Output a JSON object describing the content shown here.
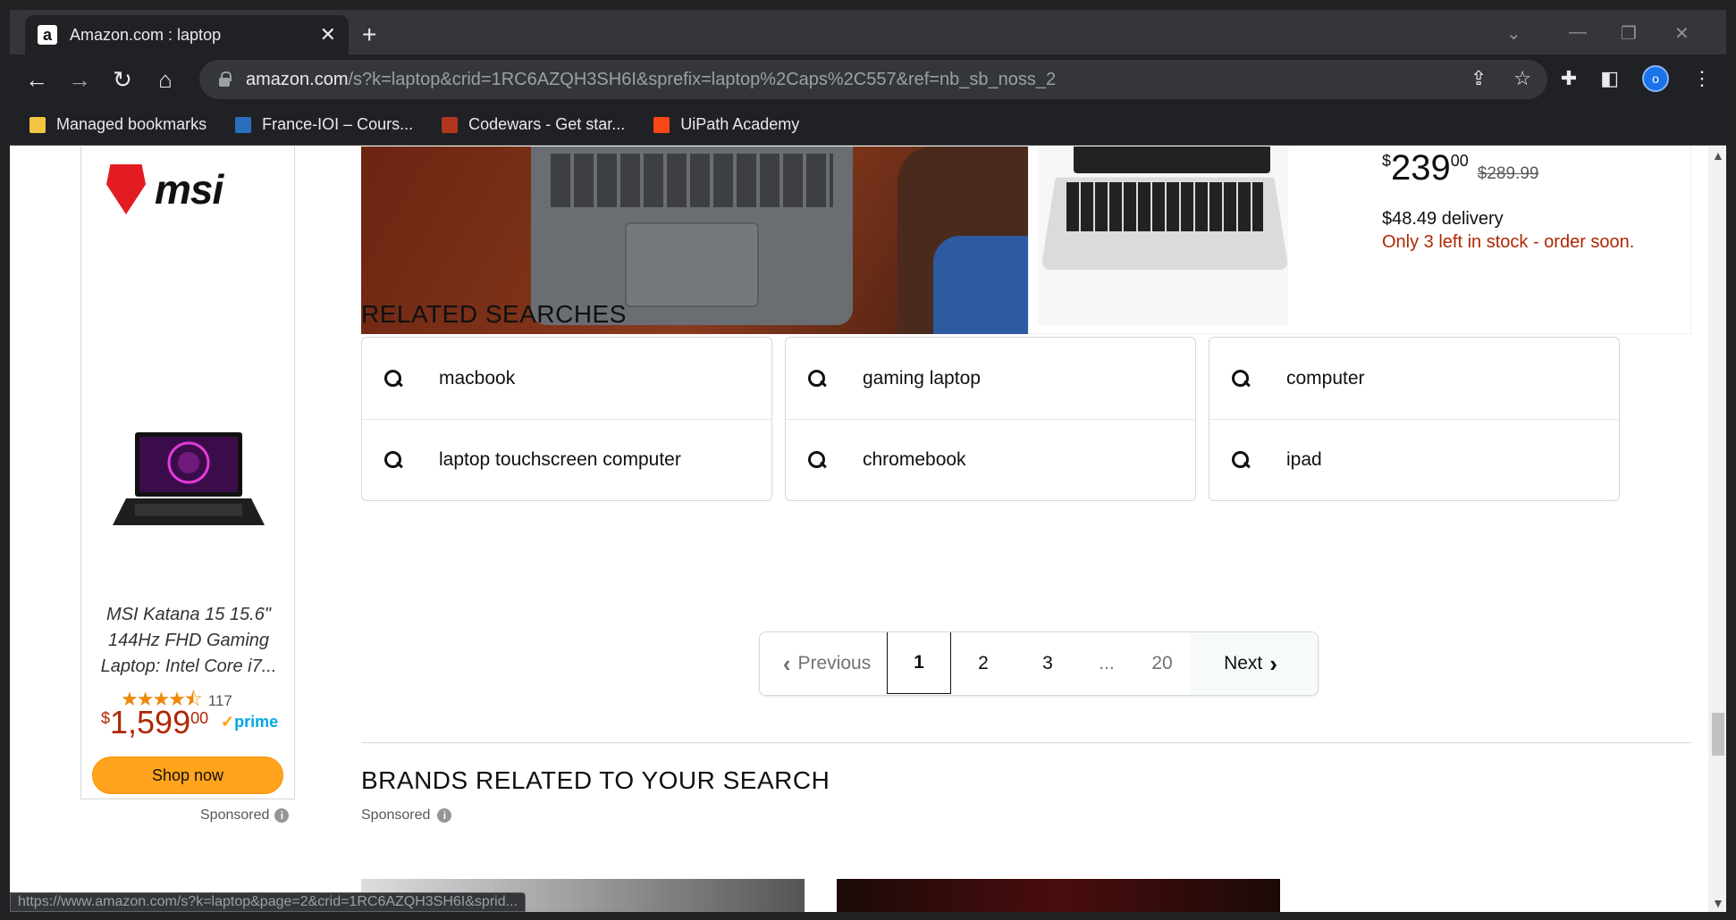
{
  "browser": {
    "tab_title": "Amazon.com : laptop",
    "tab_close": "✕",
    "new_tab": "+",
    "url_host": "amazon.com",
    "url_rest": "/s?k=laptop&crid=1RC6AZQH3SH6I&sprefix=laptop%2Caps%2C557&ref=nb_sb_noss_2",
    "profile_initial": "o",
    "bookmarks": [
      {
        "label": "Managed bookmarks",
        "color": "#f4c542"
      },
      {
        "label": "France-IOI – Cours...",
        "color": "#2a6ebb"
      },
      {
        "label": "Codewars - Get star...",
        "color": "#b1361e"
      },
      {
        "label": "UiPath Academy",
        "color": "#fa4616"
      }
    ],
    "status_url": "https://www.amazon.com/s?k=laptop&page=2&crid=1RC6AZQH3SH6I&sprid..."
  },
  "ad": {
    "brand": "msi",
    "title": "MSI Katana 15 15.6\" 144Hz FHD Gaming Laptop: Intel Core i7...",
    "rating_count": "117",
    "stars": 4.5,
    "price_currency": "$",
    "price_whole": "1,599",
    "price_fraction": "00",
    "prime": "prime",
    "shop_button": "Shop now",
    "sponsored": "Sponsored"
  },
  "product": {
    "price_currency": "$",
    "price_whole": "239",
    "price_fraction": "00",
    "was_price": "$289.99",
    "delivery": "$48.49 delivery",
    "stock": "Only 3 left in stock - order soon."
  },
  "related": {
    "title": "RELATED SEARCHES",
    "columns": [
      [
        "macbook",
        "laptop touchscreen computer"
      ],
      [
        "gaming laptop",
        "chromebook"
      ],
      [
        "computer",
        "ipad"
      ]
    ]
  },
  "pagination": {
    "previous": "Previous",
    "pages": [
      "1",
      "2",
      "3"
    ],
    "ellipsis": "...",
    "last": "20",
    "next": "Next",
    "current": "1"
  },
  "brands": {
    "title": "BRANDS RELATED TO YOUR SEARCH",
    "sponsored": "Sponsored"
  },
  "colors": {
    "accent": "#ffa41c",
    "price_red": "#b12704",
    "prime_blue": "#00a8e1"
  }
}
